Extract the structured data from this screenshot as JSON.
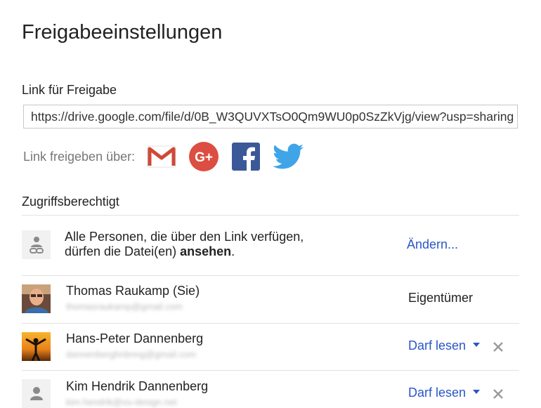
{
  "dialog": {
    "title": "Freigabeeinstellungen"
  },
  "link_section": {
    "label": "Link für Freigabe",
    "url": "https://drive.google.com/file/d/0B_W3QUVXTsO0Qm9WU0p0SzZkVjg/view?usp=sharing"
  },
  "share_via": {
    "label": "Link freigeben über:",
    "icons": [
      "gmail-icon",
      "google-plus-icon",
      "facebook-icon",
      "twitter-icon"
    ],
    "colors": {
      "gmail": "#d14836",
      "google_plus": "#dc4e41",
      "facebook": "#3b5998",
      "twitter": "#3fa4e8"
    }
  },
  "access": {
    "label": "Zugriffsberechtigt",
    "public_row": {
      "line1": "Alle Personen, die über den Link verfügen,",
      "line2_prefix": "dürfen die Datei(en) ",
      "line2_bold": "ansehen",
      "line2_suffix": ".",
      "action": "Ändern..."
    },
    "people": [
      {
        "name": "Thomas Raukamp (Sie)",
        "email": "thomasraukamp@gmail.com",
        "role": "Eigentümer"
      },
      {
        "name": "Hans-Peter Dannenberg",
        "email": "dannenberghnbnng@gmail.com",
        "role": "Darf lesen"
      },
      {
        "name": "Kim Hendrik Dannenberg",
        "email": "kim.hendrik@vu-design.net",
        "role": "Darf lesen"
      }
    ]
  },
  "colors": {
    "link_blue": "#2a56c6",
    "divider": "#e2e2e2"
  }
}
